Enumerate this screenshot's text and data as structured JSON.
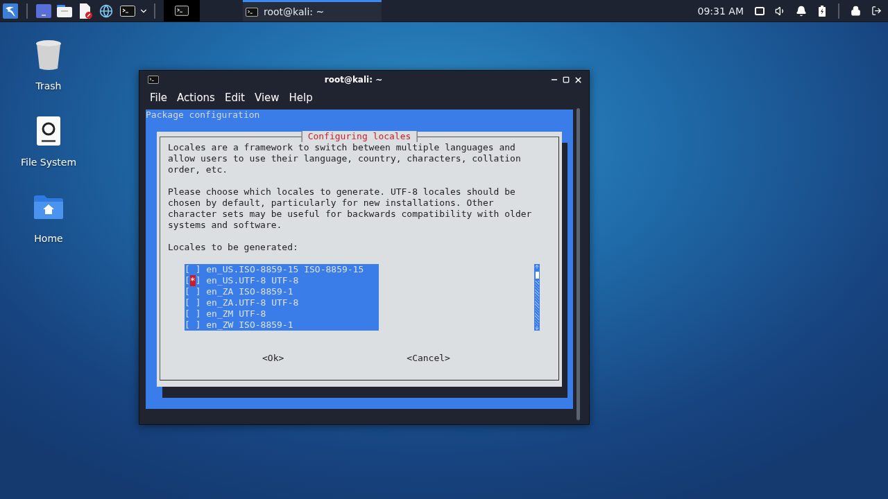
{
  "top_panel": {
    "task": {
      "title": "root@kali: ~",
      "selected": true
    },
    "clock": "09:31 AM"
  },
  "desktop_icons": [
    {
      "label": "Trash",
      "kind": "trash"
    },
    {
      "label": "File System",
      "kind": "drive"
    },
    {
      "label": "Home",
      "kind": "home"
    }
  ],
  "terminal": {
    "title": "root@kali: ~",
    "menu": [
      "File",
      "Actions",
      "Edit",
      "View",
      "Help"
    ],
    "header": "Package configuration",
    "dialog": {
      "title": "Configuring locales",
      "paragraphs": [
        "Locales are a framework to switch between multiple languages and allow users to use their language, country, characters, collation order, etc.",
        "Please choose which locales to generate. UTF-8 locales should be chosen by default, particularly for new installations. Other character sets may be useful for backwards compatibility with older systems and software.",
        "Locales to be generated:"
      ],
      "checklist": {
        "open": "[",
        "close": "]",
        "tick": "*",
        "items": [
          {
            "label": "en_US.ISO-8859-15 ISO-8859-15",
            "checked": false,
            "focused": false
          },
          {
            "label": "en_US.UTF-8 UTF-8",
            "checked": true,
            "focused": true
          },
          {
            "label": "en_ZA ISO-8859-1",
            "checked": false,
            "focused": false
          },
          {
            "label": "en_ZA.UTF-8 UTF-8",
            "checked": false,
            "focused": false
          },
          {
            "label": "en_ZM UTF-8",
            "checked": false,
            "focused": false
          },
          {
            "label": "en_ZW ISO-8859-1",
            "checked": false,
            "focused": false
          }
        ]
      },
      "buttons": [
        "<Ok>",
        "<Cancel>"
      ]
    }
  }
}
